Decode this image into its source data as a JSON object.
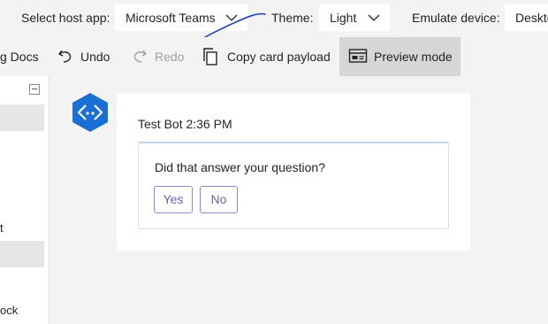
{
  "header": {
    "host_app_label": "Select host app:",
    "host_app_value": "Microsoft Teams",
    "theme_label": "Theme:",
    "theme_value": "Light",
    "device_label": "Emulate device:",
    "device_value": "Deskto"
  },
  "toolbar": {
    "docs_label": "g Docs",
    "undo_label": "Undo",
    "redo_label": "Redo",
    "copy_label": "Copy card payload",
    "preview_label": "Preview mode"
  },
  "sidebar": {
    "items": [
      "t",
      "ock"
    ]
  },
  "preview": {
    "bot_meta": "Test Bot 2:36 PM",
    "question": "Did that answer your question?",
    "actions": [
      "Yes",
      "No"
    ]
  },
  "colors": {
    "accent": "#6264a7",
    "avatar": "#1a6fd4",
    "annotation": "#1f3fbf"
  },
  "icons": {
    "chevron": "chevron-down-icon",
    "undo": "undo-icon",
    "redo": "redo-icon",
    "copy": "copy-icon",
    "preview": "preview-mode-icon",
    "bot": "bot-avatar-icon",
    "collapse": "collapse-icon"
  }
}
